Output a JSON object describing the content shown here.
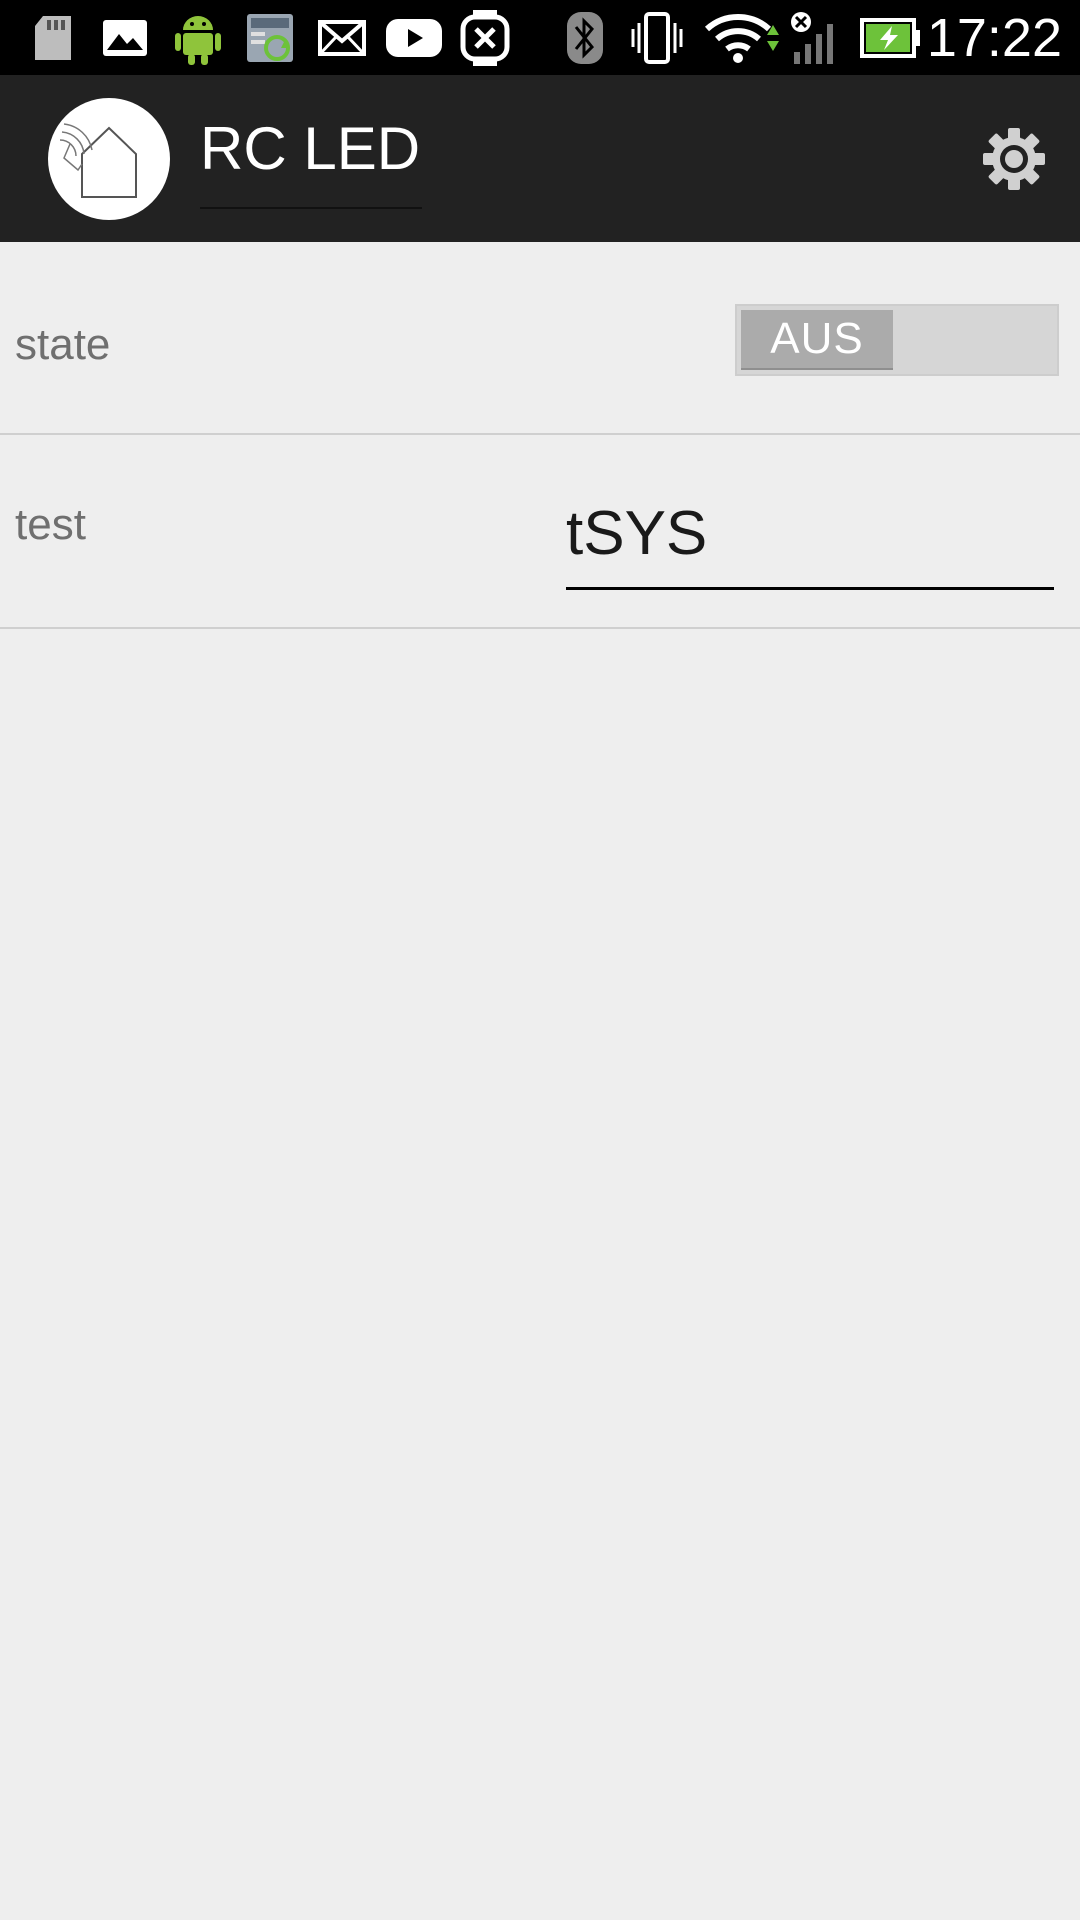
{
  "status_bar": {
    "time": "17:22",
    "icons": [
      "sd-card-icon",
      "image-icon",
      "android-icon",
      "sync-icon",
      "mail-icon",
      "youtube-icon",
      "watch-icon",
      "bluetooth-icon",
      "vibrate-icon",
      "wifi-icon",
      "signal-icon",
      "battery-charging-icon"
    ]
  },
  "action_bar": {
    "title": "RC LED",
    "logo_icon": "home-remote-icon",
    "settings_icon": "gear-icon",
    "background": "#222222"
  },
  "preferences": [
    {
      "label": "state",
      "type": "toggle",
      "value": "AUS"
    },
    {
      "label": "test",
      "type": "text",
      "value": "tSYS"
    }
  ],
  "colors": {
    "page_background": "#eeeeee",
    "status_bar": "#000000",
    "label_text": "#6f6f6f"
  }
}
